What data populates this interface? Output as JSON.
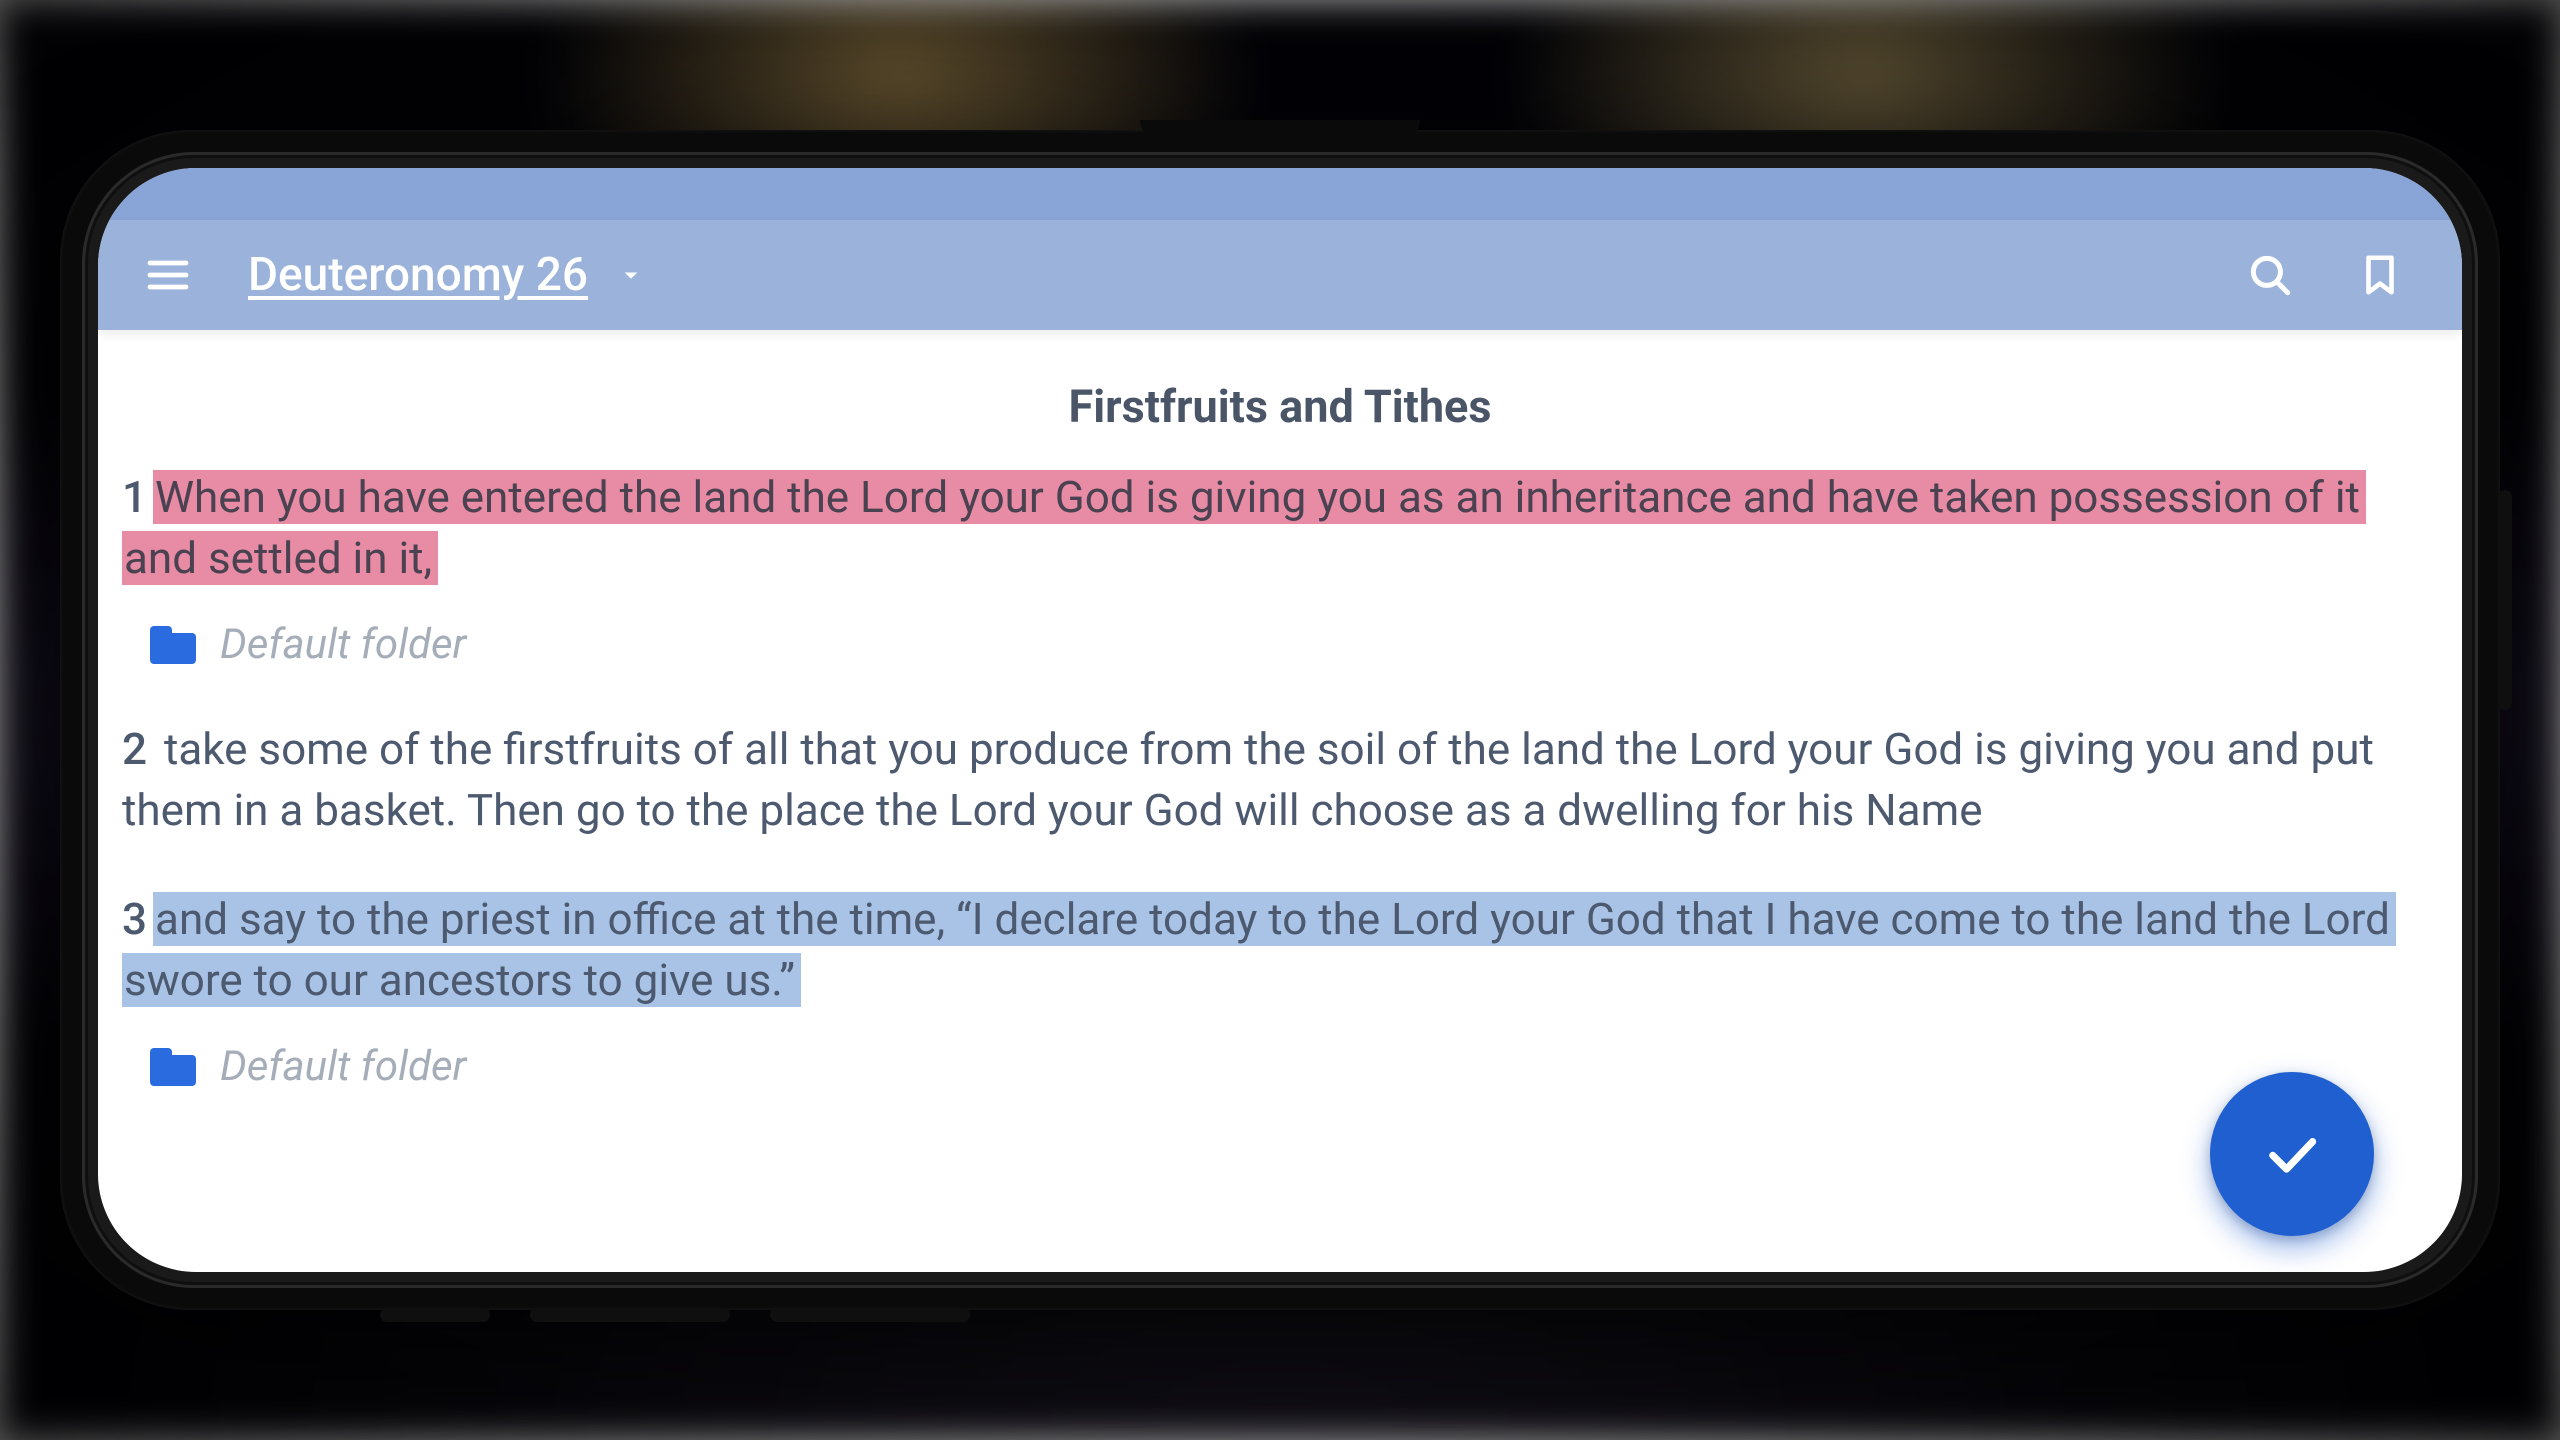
{
  "toolbar": {
    "title": "Deuteronomy 26"
  },
  "section": {
    "heading": "Firstfruits and Tithes"
  },
  "verses": [
    {
      "num": "1",
      "text": "When you have entered the land the Lord your God is giving you as an inheritance and have taken possession of it and settled in it,  ",
      "highlight": "pink",
      "folder": "Default folder"
    },
    {
      "num": "2",
      "text": "take some of the firstfruits of all that you produce from the soil of the land the Lord your God is giving you and put them in a basket. Then go to the place the Lord your God will choose as a dwelling for his Name",
      "highlight": null,
      "folder": null
    },
    {
      "num": "3",
      "text": "and say to the priest in office at the time, “I declare today to the Lord your God that I have come to the land the Lord swore to our ancestors to give us.”   ",
      "highlight": "blue",
      "folder": "Default folder"
    }
  ],
  "icons": {
    "menu": "menu-icon",
    "dropdown": "chevron-down-icon",
    "search": "search-icon",
    "bookmark": "bookmark-icon",
    "folder": "folder-icon",
    "confirm": "check-icon"
  },
  "colors": {
    "toolbar": "#9bb3db",
    "statusbar": "#89a4d6",
    "highlight_pink": "#e88ba4",
    "highlight_blue": "#a8c3e6",
    "fab": "#1f5fd0",
    "folder_icon": "#2a6be0"
  }
}
